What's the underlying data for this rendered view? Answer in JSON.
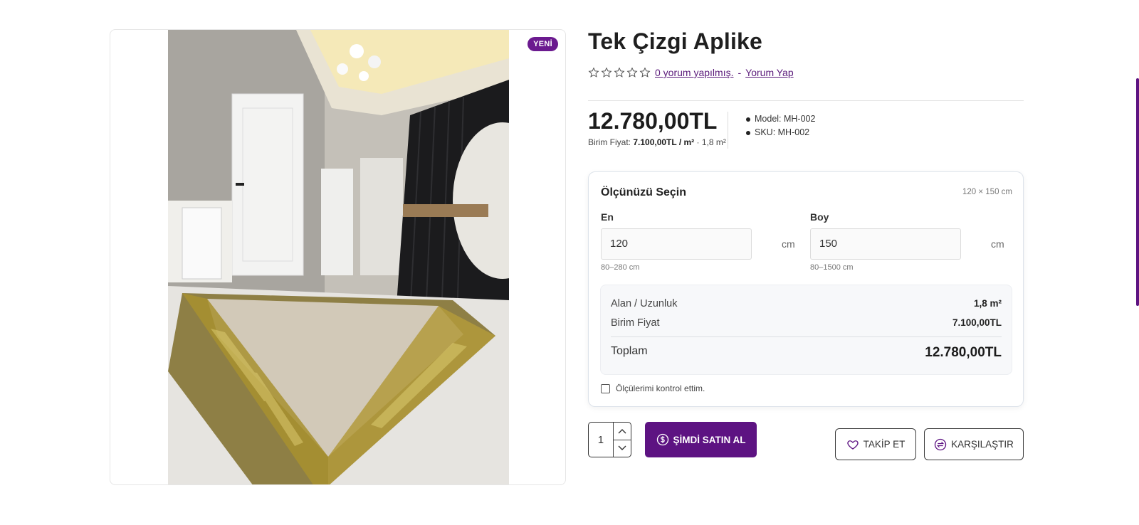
{
  "product": {
    "badge": "YENİ",
    "title": "Tek Çizgi Aplike",
    "reviews_link": "0 yorum yapılmış.",
    "review_separator": "-",
    "write_review_link": "Yorum Yap",
    "price": "12.780,00TL",
    "unit_price_label": "Birim Fiyat:",
    "unit_price_value": "7.100,00TL / m²",
    "unit_price_area": "· 1,8 m²",
    "model": "Model: MH-002",
    "sku": "SKU: MH-002"
  },
  "size_selector": {
    "title": "Ölçünüzü Seçin",
    "dims": "120 × 150 cm",
    "width_label": "En",
    "width_value": "120",
    "width_unit": "cm",
    "width_range": "80–280 cm",
    "length_label": "Boy",
    "length_value": "150",
    "length_unit": "cm",
    "length_range": "80–1500 cm",
    "area_label": "Alan / Uzunluk",
    "area_value": "1,8 m²",
    "unit_price_label": "Birim Fiyat",
    "unit_price_value": "7.100,00TL",
    "total_label": "Toplam",
    "total_value": "12.780,00TL",
    "confirm_label": "Ölçülerimi kontrol ettim."
  },
  "actions": {
    "quantity": "1",
    "buy_now": "ŞİMDİ SATIN AL",
    "follow": "TAKİP ET",
    "compare": "KARŞILAŞTIR"
  },
  "rating": {
    "stars": 5,
    "filled": 0
  },
  "colors": {
    "accent": "#5d1382",
    "badge": "#6b1a8f"
  },
  "icons": [
    "star-icon",
    "dollar-icon",
    "heart-icon",
    "compare-icon",
    "chevron-up-icon",
    "chevron-down-icon"
  ]
}
